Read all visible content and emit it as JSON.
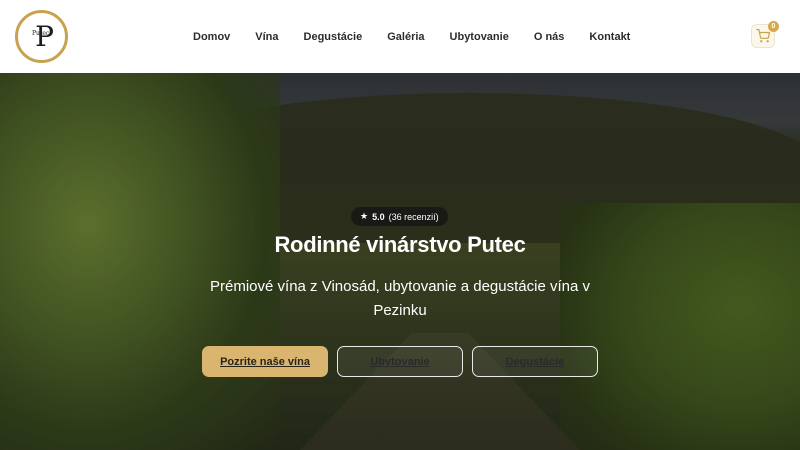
{
  "header": {
    "logo_mark": "P",
    "logo_small": "Putec",
    "nav": [
      "Domov",
      "Vína",
      "Degustácie",
      "Galéria",
      "Ubytovanie",
      "O nás",
      "Kontakt"
    ],
    "cart_count": "0",
    "cart_icon": "cart-icon"
  },
  "hero": {
    "rating_star": "★",
    "rating_score": "5.0",
    "rating_reviews": "(36 recenzií)",
    "title": "Rodinné vinárstvo Putec",
    "subtitle": "Prémiové vína z Vinosád, ubytovanie a degustácie vína v Pezinku",
    "buttons": {
      "wines": "Pozrite naše vína",
      "accommodation": "Ubytovanie",
      "tastings": "Degustácie"
    }
  },
  "colors": {
    "accent": "#d9b56f",
    "logo_ring": "#c9a24f",
    "header_bg": "#ffffff"
  }
}
